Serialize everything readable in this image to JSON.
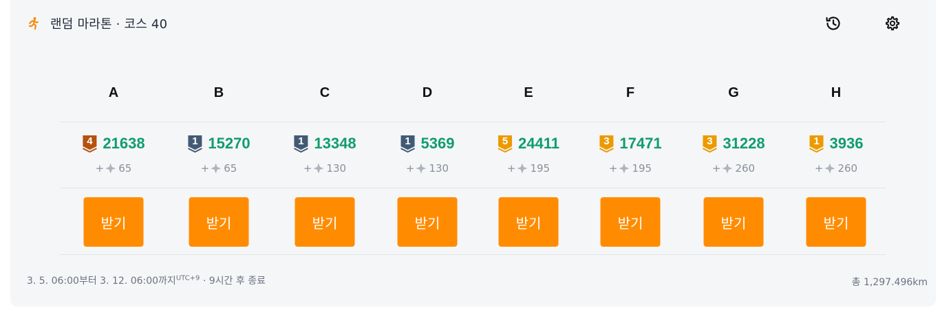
{
  "header": {
    "title": "랜덤 마라톤 · 코스 40",
    "runner_icon": "runner-icon",
    "history_icon": "history-icon",
    "settings_icon": "gear-icon"
  },
  "columns": [
    {
      "label": "A",
      "tier": "4",
      "tier_color": "#b5520d",
      "score": "21638",
      "reward": "65",
      "button": "받기"
    },
    {
      "label": "B",
      "tier": "1",
      "tier_color": "#425a74",
      "score": "15270",
      "reward": "65",
      "button": "받기"
    },
    {
      "label": "C",
      "tier": "1",
      "tier_color": "#425a74",
      "score": "13348",
      "reward": "130",
      "button": "받기"
    },
    {
      "label": "D",
      "tier": "1",
      "tier_color": "#425a74",
      "score": "5369",
      "reward": "130",
      "button": "받기"
    },
    {
      "label": "E",
      "tier": "5",
      "tier_color": "#ec9a00",
      "score": "24411",
      "reward": "195",
      "button": "받기"
    },
    {
      "label": "F",
      "tier": "3",
      "tier_color": "#ec9a00",
      "score": "17471",
      "reward": "195",
      "button": "받기"
    },
    {
      "label": "G",
      "tier": "3",
      "tier_color": "#ec9a00",
      "score": "31228",
      "reward": "260",
      "button": "받기"
    },
    {
      "label": "H",
      "tier": "1",
      "tier_color": "#ec9a00",
      "score": "3936",
      "reward": "260",
      "button": "받기"
    }
  ],
  "reward_prefix": "+",
  "colors": {
    "score": "#0f9d6b",
    "button": "#ff8c00",
    "accent_runner": "#f28c12"
  },
  "footer": {
    "period": "3. 5. 06:00부터 3. 12. 06:00까지",
    "timezone": "UTC+9",
    "remaining": " · 9시간 후 종료",
    "total": "총 1,297.496km"
  }
}
